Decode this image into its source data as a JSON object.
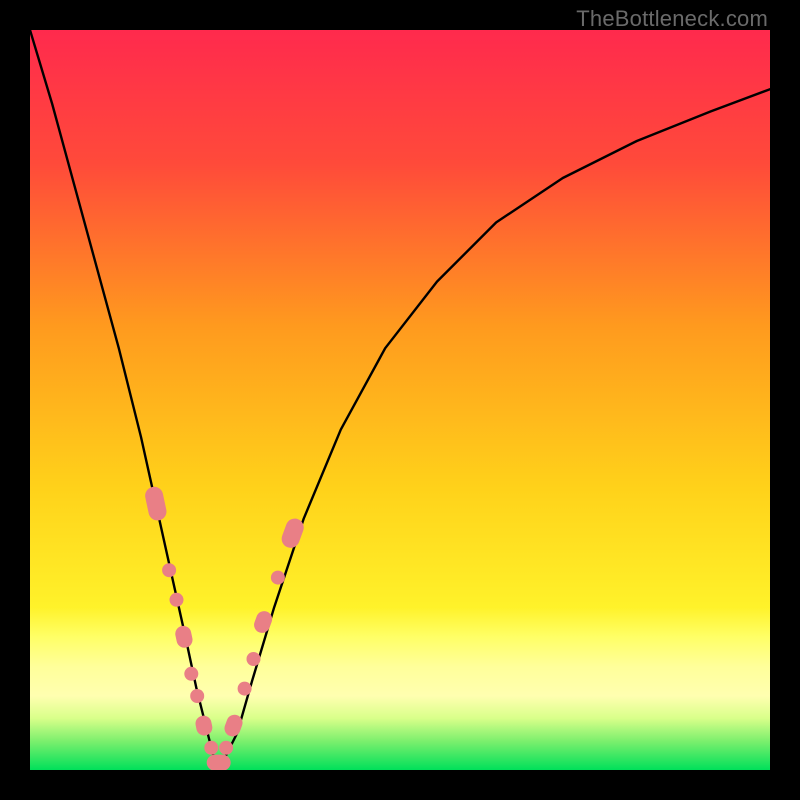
{
  "watermark": "TheBottleneck.com",
  "colors": {
    "frame_bg": "#000000",
    "grad_top": "#ff2a4d",
    "grad_mid1": "#ff7a2a",
    "grad_mid2": "#ffd21a",
    "grad_mid3": "#f6ff4d",
    "grad_band": "#ffff88",
    "grad_green1": "#6fe66a",
    "grad_green2": "#00e05a",
    "curve": "#000000",
    "marker_fill": "#e97f86",
    "marker_stroke": "#cf6b73"
  },
  "chart_data": {
    "type": "line",
    "title": "",
    "xlabel": "",
    "ylabel": "",
    "xlim": [
      0,
      100
    ],
    "ylim": [
      0,
      100
    ],
    "series": [
      {
        "name": "bottleneck-curve",
        "x": [
          0,
          3,
          6,
          9,
          12,
          15,
          17,
          19,
          21,
          22.5,
          24,
          25,
          26,
          28,
          30,
          33,
          37,
          42,
          48,
          55,
          63,
          72,
          82,
          92,
          100
        ],
        "y": [
          100,
          90,
          79,
          68,
          57,
          45,
          36,
          27,
          18,
          11,
          5,
          1,
          1,
          5,
          12,
          22,
          34,
          46,
          57,
          66,
          74,
          80,
          85,
          89,
          92
        ]
      }
    ],
    "markers": {
      "name": "highlight-cluster",
      "points": [
        {
          "x": 17.0,
          "y": 36,
          "r": 9,
          "shape": "pill",
          "len": 34
        },
        {
          "x": 18.8,
          "y": 27,
          "r": 7,
          "shape": "dot"
        },
        {
          "x": 19.8,
          "y": 23,
          "r": 7,
          "shape": "dot"
        },
        {
          "x": 20.8,
          "y": 18,
          "r": 8,
          "shape": "pill",
          "len": 22
        },
        {
          "x": 21.8,
          "y": 13,
          "r": 7,
          "shape": "dot"
        },
        {
          "x": 22.6,
          "y": 10,
          "r": 7,
          "shape": "dot"
        },
        {
          "x": 23.5,
          "y": 6,
          "r": 8,
          "shape": "pill",
          "len": 20
        },
        {
          "x": 24.5,
          "y": 3,
          "r": 7,
          "shape": "dot"
        },
        {
          "x": 25.5,
          "y": 1,
          "r": 8,
          "shape": "pill",
          "len": 24,
          "horiz": true
        },
        {
          "x": 26.5,
          "y": 3,
          "r": 7,
          "shape": "dot"
        },
        {
          "x": 27.5,
          "y": 6,
          "r": 8,
          "shape": "pill",
          "len": 22
        },
        {
          "x": 29.0,
          "y": 11,
          "r": 7,
          "shape": "dot"
        },
        {
          "x": 30.2,
          "y": 15,
          "r": 7,
          "shape": "dot"
        },
        {
          "x": 31.5,
          "y": 20,
          "r": 8,
          "shape": "pill",
          "len": 22
        },
        {
          "x": 33.5,
          "y": 26,
          "r": 7,
          "shape": "dot"
        },
        {
          "x": 35.5,
          "y": 32,
          "r": 9,
          "shape": "pill",
          "len": 30
        }
      ]
    }
  }
}
